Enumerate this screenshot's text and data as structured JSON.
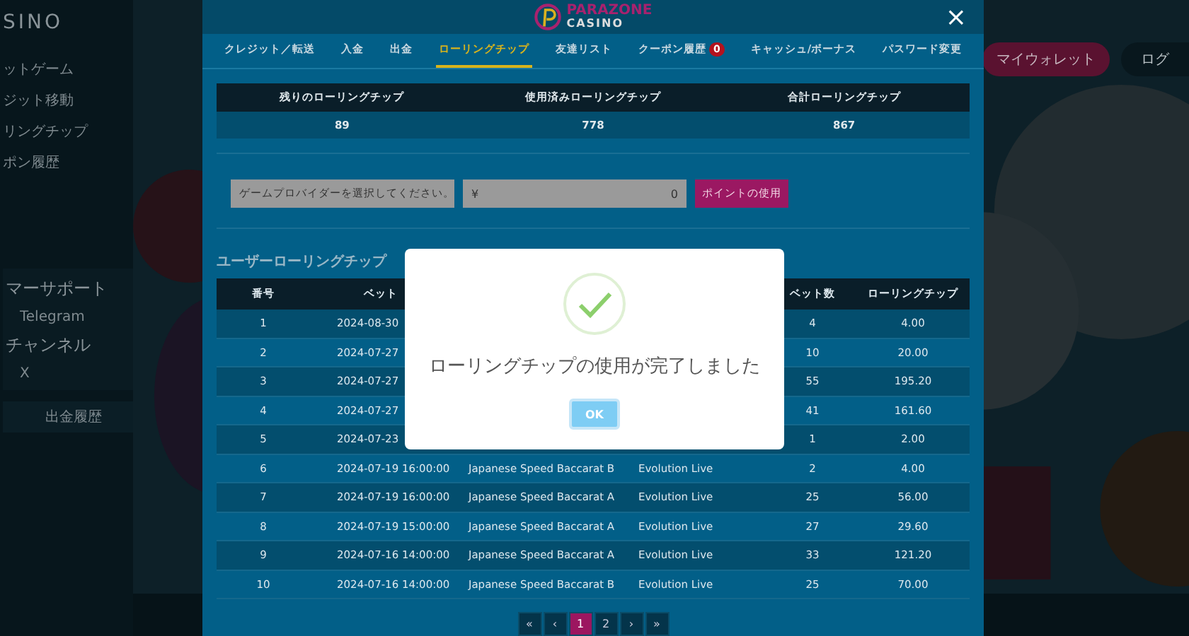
{
  "background": {
    "sidebar_logo": "SINO",
    "sidebar_items": [
      "ットゲーム",
      "ジット移動",
      "リングチップ",
      "ポン履歴"
    ],
    "support_title": "マーサポート",
    "telegram": "Telegram",
    "channel_title": "チャンネル",
    "x_link": "X",
    "withdraw_history": "出金履歴",
    "wallet_button": "マイウォレット",
    "login_button": "ログ"
  },
  "modal": {
    "logo_top": "PARAZONE",
    "logo_bottom": "CASINO",
    "close": "×",
    "tabs": [
      {
        "label": "クレジット／転送",
        "selected": false
      },
      {
        "label": "入金",
        "selected": false
      },
      {
        "label": "出金",
        "selected": false
      },
      {
        "label": "ローリングチップ",
        "selected": true
      },
      {
        "label": "友達リスト",
        "selected": false
      },
      {
        "label": "クーポン履歴",
        "selected": false,
        "badge": "0"
      },
      {
        "label": "キャッシュ/ボーナス",
        "selected": false
      },
      {
        "label": "パスワード変更",
        "selected": false
      }
    ],
    "summary": {
      "columns": [
        "残りのローリングチップ",
        "使用済みローリングチップ",
        "合計ローリングチップ"
      ],
      "values": [
        "89",
        "778",
        "867"
      ]
    },
    "provider_select": {
      "value": "ゲームプロバイダーを選択してください。"
    },
    "amount_field": {
      "currency": "¥",
      "value": "0"
    },
    "use_button": "ポイントの使用",
    "section_title": "ユーザーローリングチップ",
    "table": {
      "columns": [
        "番号",
        "ベット",
        "",
        "",
        "ベット数",
        "ローリングチップ"
      ],
      "rows": [
        {
          "no": "1",
          "time": "2024-08-30",
          "count": "4",
          "chip": "4.00"
        },
        {
          "no": "2",
          "time": "2024-07-27",
          "count": "10",
          "chip": "20.00"
        },
        {
          "no": "3",
          "time": "2024-07-27",
          "count": "55",
          "chip": "195.20"
        },
        {
          "no": "4",
          "time": "2024-07-27",
          "count": "41",
          "chip": "161.60"
        },
        {
          "no": "5",
          "time": "2024-07-23",
          "count": "1",
          "chip": "2.00"
        },
        {
          "no": "6",
          "time": "2024-07-19 16:00:00",
          "game": "Japanese Speed Baccarat B",
          "provider": "Evolution Live",
          "count": "2",
          "chip": "4.00"
        },
        {
          "no": "7",
          "time": "2024-07-19 16:00:00",
          "game": "Japanese Speed Baccarat A",
          "provider": "Evolution Live",
          "count": "25",
          "chip": "56.00"
        },
        {
          "no": "8",
          "time": "2024-07-19 15:00:00",
          "game": "Japanese Speed Baccarat A",
          "provider": "Evolution Live",
          "count": "27",
          "chip": "29.60"
        },
        {
          "no": "9",
          "time": "2024-07-16 14:00:00",
          "game": "Japanese Speed Baccarat A",
          "provider": "Evolution Live",
          "count": "33",
          "chip": "121.20"
        },
        {
          "no": "10",
          "time": "2024-07-16 14:00:00",
          "game": "Japanese Speed Baccarat B",
          "provider": "Evolution Live",
          "count": "25",
          "chip": "70.00"
        }
      ]
    },
    "pagination": [
      {
        "label": "«",
        "selected": false
      },
      {
        "label": "‹",
        "selected": false
      },
      {
        "label": "1",
        "selected": true
      },
      {
        "label": "2",
        "selected": false
      },
      {
        "label": "›",
        "selected": false
      },
      {
        "label": "»",
        "selected": false
      }
    ]
  },
  "alert": {
    "message": "ローリングチップの使用が完了しました",
    "button": "OK"
  }
}
